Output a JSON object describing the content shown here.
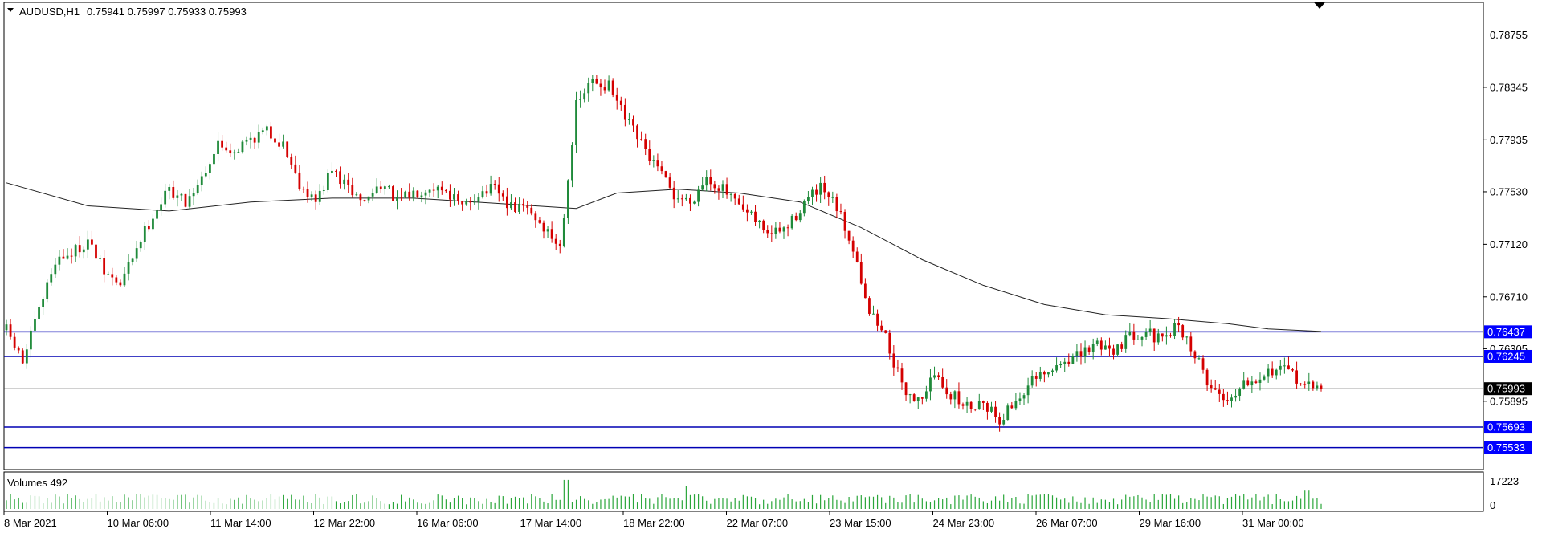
{
  "header": {
    "symbol": "AUDUSD,H1",
    "ohlc": "0.75941 0.75997 0.75933 0.75993",
    "volumes_label": "Volumes 492"
  },
  "colors": {
    "background": "#ffffff",
    "bull": "#1f8a3a",
    "bear": "#d40000",
    "ma": "#222222",
    "hline": "#0000b4",
    "price_tag": "#0000ff",
    "current_tag": "#000000",
    "volume": "#2aa63a"
  },
  "chart_data": {
    "type": "candlestick",
    "symbol": "AUDUSD",
    "timeframe": "H1",
    "y_ticks": [
      "0.78755",
      "0.78345",
      "0.77935",
      "0.77530",
      "0.77120",
      "0.76710",
      "0.76305",
      "0.75895"
    ],
    "ylim": [
      0.7538,
      0.7899
    ],
    "x_ticks": [
      "8 Mar 2021",
      "10 Mar 06:00",
      "11 Mar 14:00",
      "12 Mar 22:00",
      "16 Mar 06:00",
      "17 Mar 14:00",
      "18 Mar 22:00",
      "22 Mar 07:00",
      "23 Mar 15:00",
      "24 Mar 23:00",
      "26 Mar 07:00",
      "29 Mar 16:00",
      "31 Mar 00:00"
    ],
    "close_path": [
      [
        0,
        0.7645
      ],
      [
        4,
        0.762
      ],
      [
        8,
        0.766
      ],
      [
        12,
        0.77
      ],
      [
        16,
        0.7705
      ],
      [
        20,
        0.7715
      ],
      [
        24,
        0.769
      ],
      [
        28,
        0.768
      ],
      [
        32,
        0.771
      ],
      [
        36,
        0.7735
      ],
      [
        40,
        0.7755
      ],
      [
        44,
        0.7745
      ],
      [
        48,
        0.7765
      ],
      [
        52,
        0.779
      ],
      [
        56,
        0.7785
      ],
      [
        60,
        0.7795
      ],
      [
        64,
        0.78
      ],
      [
        68,
        0.779
      ],
      [
        72,
        0.776
      ],
      [
        76,
        0.7745
      ],
      [
        80,
        0.777
      ],
      [
        84,
        0.7755
      ],
      [
        88,
        0.7745
      ],
      [
        92,
        0.776
      ],
      [
        96,
        0.7745
      ],
      [
        100,
        0.7752
      ],
      [
        104,
        0.7758
      ],
      [
        108,
        0.7755
      ],
      [
        112,
        0.774
      ],
      [
        116,
        0.7752
      ],
      [
        120,
        0.7755
      ],
      [
        124,
        0.774
      ],
      [
        128,
        0.774
      ],
      [
        132,
        0.7725
      ],
      [
        136,
        0.771
      ],
      [
        140,
        0.782
      ],
      [
        144,
        0.784
      ],
      [
        148,
        0.7835
      ],
      [
        152,
        0.781
      ],
      [
        156,
        0.779
      ],
      [
        160,
        0.777
      ],
      [
        164,
        0.775
      ],
      [
        168,
        0.7745
      ],
      [
        172,
        0.7765
      ],
      [
        176,
        0.7755
      ],
      [
        180,
        0.774
      ],
      [
        184,
        0.773
      ],
      [
        188,
        0.772
      ],
      [
        192,
        0.7725
      ],
      [
        196,
        0.7745
      ],
      [
        200,
        0.7755
      ],
      [
        204,
        0.774
      ],
      [
        208,
        0.771
      ],
      [
        212,
        0.766
      ],
      [
        216,
        0.764
      ],
      [
        220,
        0.76
      ],
      [
        224,
        0.759
      ],
      [
        228,
        0.761
      ],
      [
        232,
        0.7595
      ],
      [
        236,
        0.7585
      ],
      [
        240,
        0.759
      ],
      [
        244,
        0.7575
      ],
      [
        248,
        0.759
      ],
      [
        252,
        0.7605
      ],
      [
        256,
        0.761
      ],
      [
        260,
        0.7622
      ],
      [
        264,
        0.7625
      ],
      [
        268,
        0.7635
      ],
      [
        272,
        0.763
      ],
      [
        276,
        0.764
      ],
      [
        280,
        0.7645
      ],
      [
        284,
        0.7635
      ],
      [
        288,
        0.765
      ],
      [
        292,
        0.7625
      ],
      [
        296,
        0.76
      ],
      [
        300,
        0.759
      ],
      [
        304,
        0.7605
      ],
      [
        308,
        0.761
      ],
      [
        312,
        0.7615
      ],
      [
        316,
        0.761
      ],
      [
        320,
        0.76
      ],
      [
        323,
        0.7599
      ]
    ],
    "moving_average": [
      [
        0,
        0.776
      ],
      [
        20,
        0.7742
      ],
      [
        40,
        0.7738
      ],
      [
        60,
        0.7745
      ],
      [
        80,
        0.7748
      ],
      [
        100,
        0.7748
      ],
      [
        120,
        0.7744
      ],
      [
        140,
        0.774
      ],
      [
        150,
        0.7752
      ],
      [
        165,
        0.7755
      ],
      [
        180,
        0.7752
      ],
      [
        195,
        0.7745
      ],
      [
        210,
        0.7725
      ],
      [
        225,
        0.77
      ],
      [
        240,
        0.768
      ],
      [
        255,
        0.7665
      ],
      [
        270,
        0.7657
      ],
      [
        285,
        0.7654
      ],
      [
        300,
        0.765
      ],
      [
        310,
        0.7646
      ],
      [
        323,
        0.7644
      ]
    ],
    "horizontal_levels": [
      {
        "price": 0.76437,
        "label": "0.76437"
      },
      {
        "price": 0.76245,
        "label": "0.76245"
      },
      {
        "price": 0.75693,
        "label": "0.75693"
      },
      {
        "price": 0.75533,
        "label": "0.75533"
      }
    ],
    "current_price": {
      "price": 0.75993,
      "label": "0.75993"
    },
    "volume_axis": {
      "ticks": [
        "17223",
        "0"
      ],
      "max": 17223
    }
  }
}
